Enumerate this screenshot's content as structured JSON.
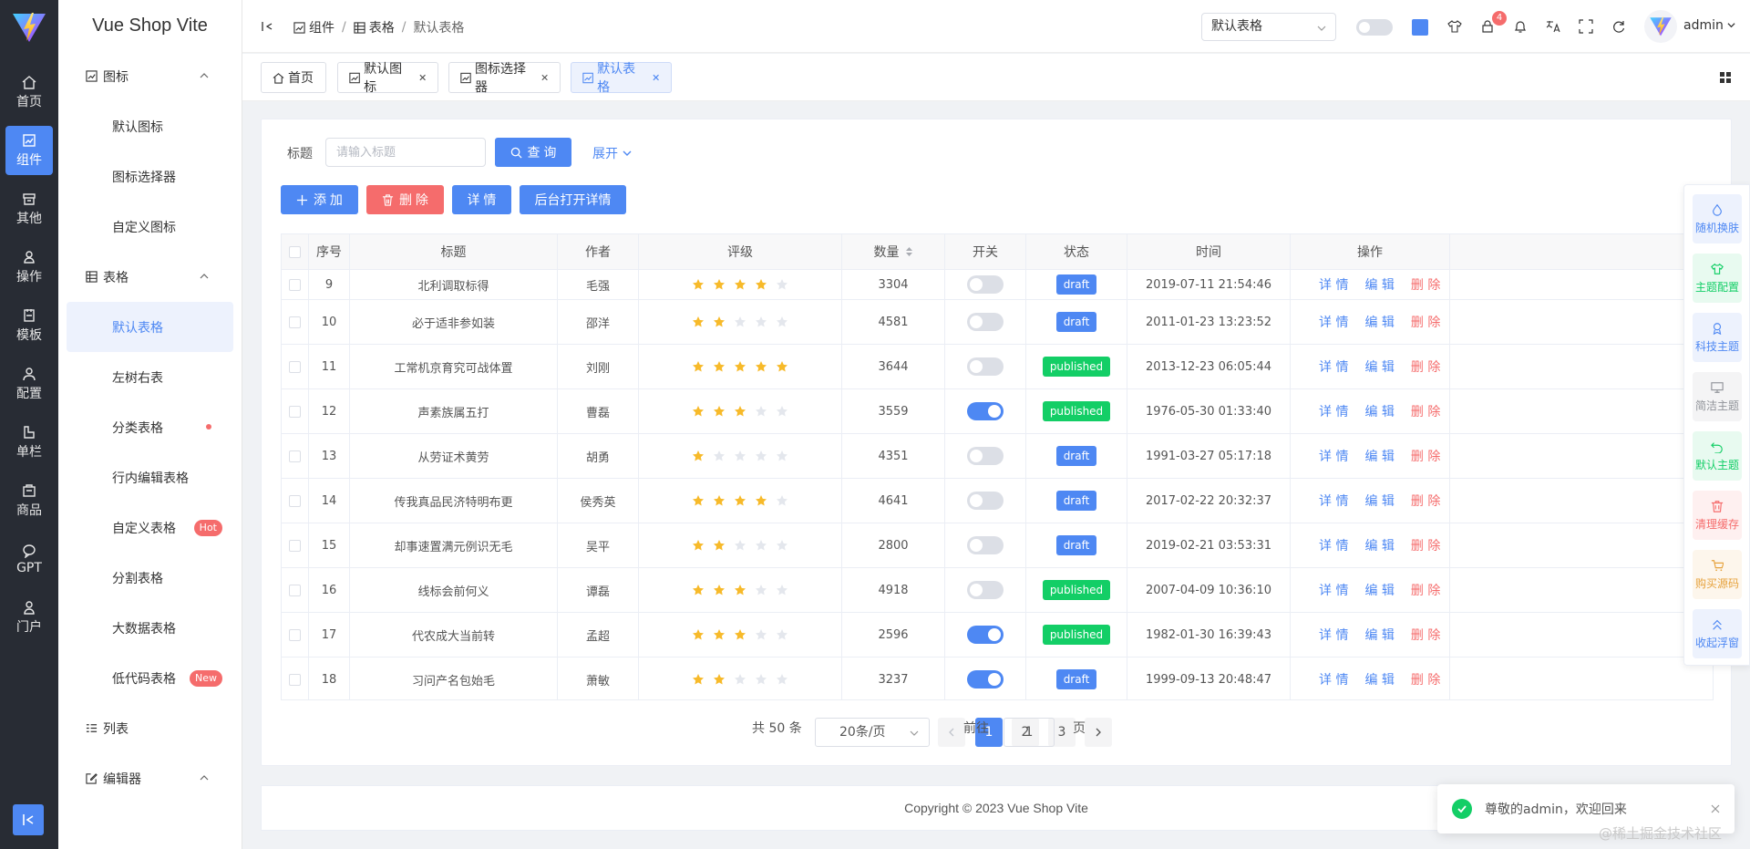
{
  "app": {
    "title": "Vue Shop Vite"
  },
  "rail": {
    "items": [
      {
        "label": "首页",
        "icon": "home-icon"
      },
      {
        "label": "组件",
        "icon": "component-icon",
        "active": true
      },
      {
        "label": "其他",
        "icon": "box-icon"
      },
      {
        "label": "操作",
        "icon": "operation-icon"
      },
      {
        "label": "模板",
        "icon": "template-icon"
      },
      {
        "label": "配置",
        "icon": "user-config-icon"
      },
      {
        "label": "单栏",
        "icon": "single-column-icon"
      },
      {
        "label": "商品",
        "icon": "goods-icon"
      },
      {
        "label": "GPT",
        "icon": "chat-icon"
      },
      {
        "label": "门户",
        "icon": "portal-icon"
      }
    ]
  },
  "menu": {
    "icons_group": "图标",
    "icons_items": [
      "默认图标",
      "图标选择器",
      "自定义图标"
    ],
    "table_group": "表格",
    "table_items": [
      "默认表格",
      "左树右表",
      "分类表格",
      "行内编辑表格",
      "自定义表格",
      "分割表格",
      "大数据表格",
      "低代码表格"
    ],
    "hot_tag": "Hot",
    "new_tag": "New",
    "list_group": "列表",
    "editor_group": "编辑器"
  },
  "header": {
    "breadcrumb": [
      "组件",
      "表格",
      "默认表格"
    ],
    "select_value": "默认表格",
    "notice_count": "4",
    "user": "admin"
  },
  "tabs": [
    "首页",
    "默认图标",
    "图标选择器",
    "默认表格"
  ],
  "search": {
    "label": "标题",
    "placeholder": "请输入标题",
    "query_btn": "查 询",
    "expand": "展开"
  },
  "actions": {
    "add": "添 加",
    "delete": "删 除",
    "detail": "详 情",
    "bg_open": "后台打开详情"
  },
  "table": {
    "columns": [
      "序号",
      "标题",
      "作者",
      "评级",
      "数量",
      "开关",
      "状态",
      "时间",
      "操作"
    ],
    "row_actions": {
      "detail": "详 情",
      "edit": "编 辑",
      "delete": "删 除"
    },
    "rows": [
      {
        "id": "9",
        "title": "北利调取标得",
        "author": "毛强",
        "rating": 4,
        "count": "3304",
        "on": false,
        "status": "draft",
        "time": "2019-07-11 21:54:46"
      },
      {
        "id": "10",
        "title": "必于适非参如装",
        "author": "邵洋",
        "rating": 2,
        "count": "4581",
        "on": false,
        "status": "draft",
        "time": "2011-01-23 13:23:52"
      },
      {
        "id": "11",
        "title": "工常机京育究可战体置",
        "author": "刘刚",
        "rating": 5,
        "count": "3644",
        "on": false,
        "status": "published",
        "time": "2013-12-23 06:05:44"
      },
      {
        "id": "12",
        "title": "声素族属五打",
        "author": "曹磊",
        "rating": 3,
        "count": "3559",
        "on": true,
        "status": "published",
        "time": "1976-05-30 01:33:40"
      },
      {
        "id": "13",
        "title": "从劳证术黄劳",
        "author": "胡勇",
        "rating": 1,
        "count": "4351",
        "on": false,
        "status": "draft",
        "time": "1991-03-27 05:17:18"
      },
      {
        "id": "14",
        "title": "传我真品民济特明布更",
        "author": "侯秀英",
        "rating": 4,
        "count": "4641",
        "on": false,
        "status": "draft",
        "time": "2017-02-22 20:32:37"
      },
      {
        "id": "15",
        "title": "却事速置满元例识无毛",
        "author": "吴平",
        "rating": 2,
        "count": "2800",
        "on": false,
        "status": "draft",
        "time": "2019-02-21 03:53:31"
      },
      {
        "id": "16",
        "title": "线标会前何义",
        "author": "谭磊",
        "rating": 3,
        "count": "4918",
        "on": false,
        "status": "published",
        "time": "2007-04-09 10:36:10"
      },
      {
        "id": "17",
        "title": "代农成大当前转",
        "author": "孟超",
        "rating": 3,
        "count": "2596",
        "on": true,
        "status": "published",
        "time": "1982-01-30 16:39:43"
      },
      {
        "id": "18",
        "title": "习问产名包始毛",
        "author": "萧敏",
        "rating": 2,
        "count": "3237",
        "on": true,
        "status": "draft",
        "time": "1999-09-13 20:48:47"
      }
    ]
  },
  "pagination": {
    "total": "共 50 条",
    "page_size": "20条/页",
    "pages": [
      "1",
      "2",
      "3"
    ],
    "current": "1",
    "goto_label": "前往",
    "goto_value": "1",
    "page_unit": "页"
  },
  "footer": {
    "copyright": "Copyright © 2023 Vue Shop Vite"
  },
  "float_panel": [
    {
      "label": "随机换肤",
      "color": "#4e88f3",
      "bg": "#edf2fd",
      "icon": "drop-icon"
    },
    {
      "label": "主题配置",
      "color": "#13ce66",
      "bg": "#e8faf0",
      "icon": "shirt-icon"
    },
    {
      "label": "科技主题",
      "color": "#4e88f3",
      "bg": "#edf2fd",
      "icon": "tech-icon"
    },
    {
      "label": "简洁主题",
      "color": "#909399",
      "bg": "#f4f4f5",
      "icon": "monitor-icon"
    },
    {
      "label": "默认主题",
      "color": "#13ce66",
      "bg": "#e8faf0",
      "icon": "undo-icon"
    },
    {
      "label": "清理缓存",
      "color": "#f56c6c",
      "bg": "#fef0f0",
      "icon": "trash-icon"
    },
    {
      "label": "购买源码",
      "color": "#e6a23c",
      "bg": "#fdf6ec",
      "icon": "cart-icon"
    },
    {
      "label": "收起浮窗",
      "color": "#4e88f3",
      "bg": "#edf2fd",
      "icon": "double-up-icon"
    }
  ],
  "toast": {
    "message": "尊敬的admin，欢迎回来"
  },
  "watermark": "@稀土掘金技术社区",
  "colors": {
    "primary": "#4e88f3",
    "danger": "#f56c6c",
    "success": "#13ce66",
    "rail_bg": "#282c34",
    "star": "#f7ba2a"
  }
}
